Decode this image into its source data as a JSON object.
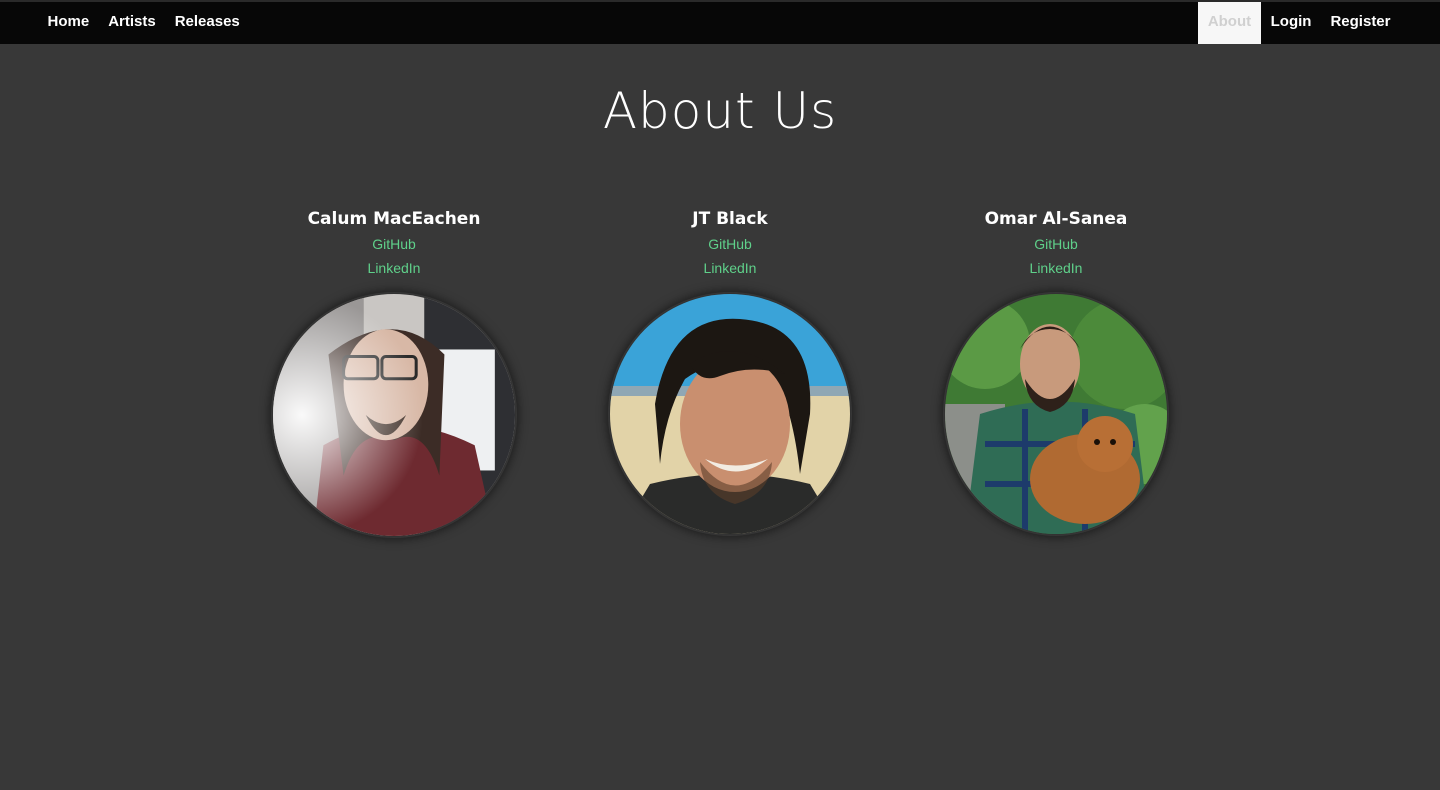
{
  "nav": {
    "left": [
      {
        "label": "Home"
      },
      {
        "label": "Artists"
      },
      {
        "label": "Releases"
      }
    ],
    "right": [
      {
        "label": "About"
      },
      {
        "label": "Login"
      },
      {
        "label": "Register"
      }
    ]
  },
  "page": {
    "title": "About Us"
  },
  "team": [
    {
      "name": "Calum MacEachen",
      "github": "GitHub",
      "linkedin": "LinkedIn"
    },
    {
      "name": "JT Black",
      "github": "GitHub",
      "linkedin": "LinkedIn"
    },
    {
      "name": "Omar Al-Sanea",
      "github": "GitHub",
      "linkedin": "LinkedIn"
    }
  ],
  "colors": {
    "background": "#383838",
    "navbar": "#070707",
    "link": "#5fd08a",
    "active_tab": "#f7f7f7"
  }
}
